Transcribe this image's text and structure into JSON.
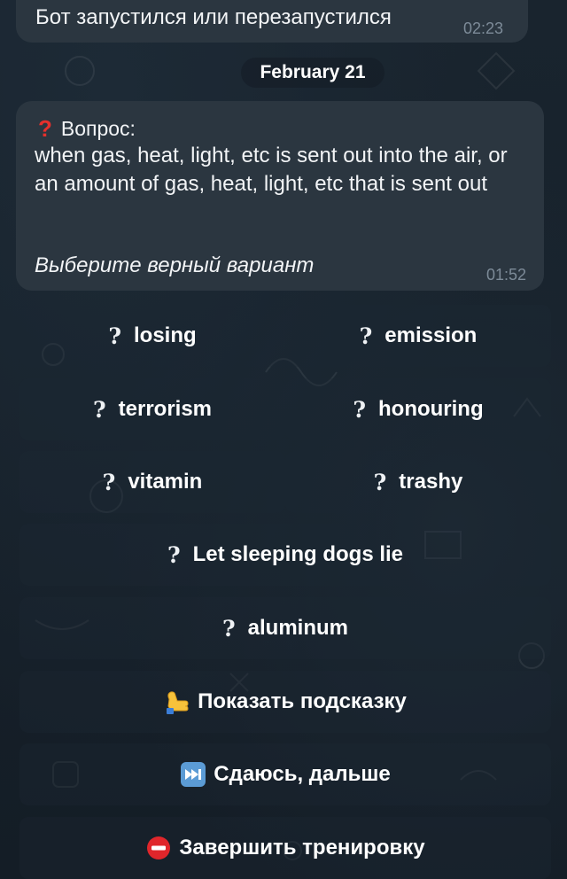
{
  "messages": [
    {
      "text": "Бот запустился или перезапустился",
      "time": "02:23"
    }
  ],
  "date_separator": "February 21",
  "question": {
    "icon": "?",
    "heading": "Вопрос:",
    "definition": "when gas, heat, light, etc is sent out into the air, or an amount of gas, heat, light, etc that is sent out",
    "prompt": "Выберите верный вариант",
    "time": "01:52"
  },
  "keyboard": {
    "option_icon": "?",
    "options": [
      "losing",
      "emission",
      "terrorism",
      "honouring",
      "vitamin",
      "trashy",
      "Let sleeping dogs lie",
      "aluminum"
    ],
    "actions": [
      {
        "icon": "call-me-hand-icon",
        "label": "Показать подсказку"
      },
      {
        "icon": "next-track-icon",
        "label": "Сдаюсь, дальше"
      },
      {
        "icon": "stop-sign-icon",
        "label": "Завершить тренировку"
      }
    ]
  },
  "colors": {
    "background": "#17212b",
    "bubble": "#2b3640",
    "time_text": "#7d8b98",
    "question_mark": "#e5302c"
  }
}
